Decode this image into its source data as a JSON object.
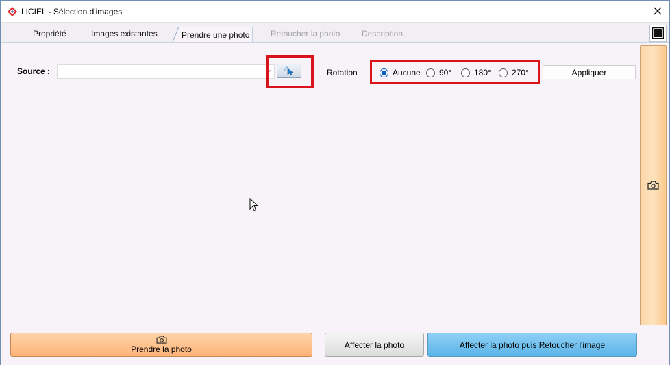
{
  "window": {
    "title": "LICIEL - Sélection d'images"
  },
  "tabs": [
    {
      "label": "Propriété",
      "state": "normal"
    },
    {
      "label": "Images existantes",
      "state": "normal"
    },
    {
      "label": "Prendre une photo",
      "state": "active"
    },
    {
      "label": "Retoucher la photo",
      "state": "disabled"
    },
    {
      "label": "Description",
      "state": "disabled"
    }
  ],
  "source": {
    "label": "Source :",
    "value": ""
  },
  "rotation": {
    "label": "Rotation",
    "options": [
      "Aucune",
      "90°",
      "180°",
      "270°"
    ],
    "selected": "Aucune",
    "apply_label": "Appliquer"
  },
  "buttons": {
    "take_photo": "Prendre la photo",
    "assign_photo": "Affecter la photo",
    "assign_and_retouch": "Affecter la photo puis Retoucher l'image"
  },
  "icons": {
    "app_logo": "liciel-logo-icon",
    "close": "close-icon",
    "maximize": "maximize-icon",
    "camera": "camera-icon",
    "picker": "pointer-select-icon"
  },
  "colors": {
    "highlight": "#d9131c",
    "orange_button": "#fdb27a",
    "blue_button": "#5bb4e8",
    "radio_selected": "#0a5fc4"
  }
}
